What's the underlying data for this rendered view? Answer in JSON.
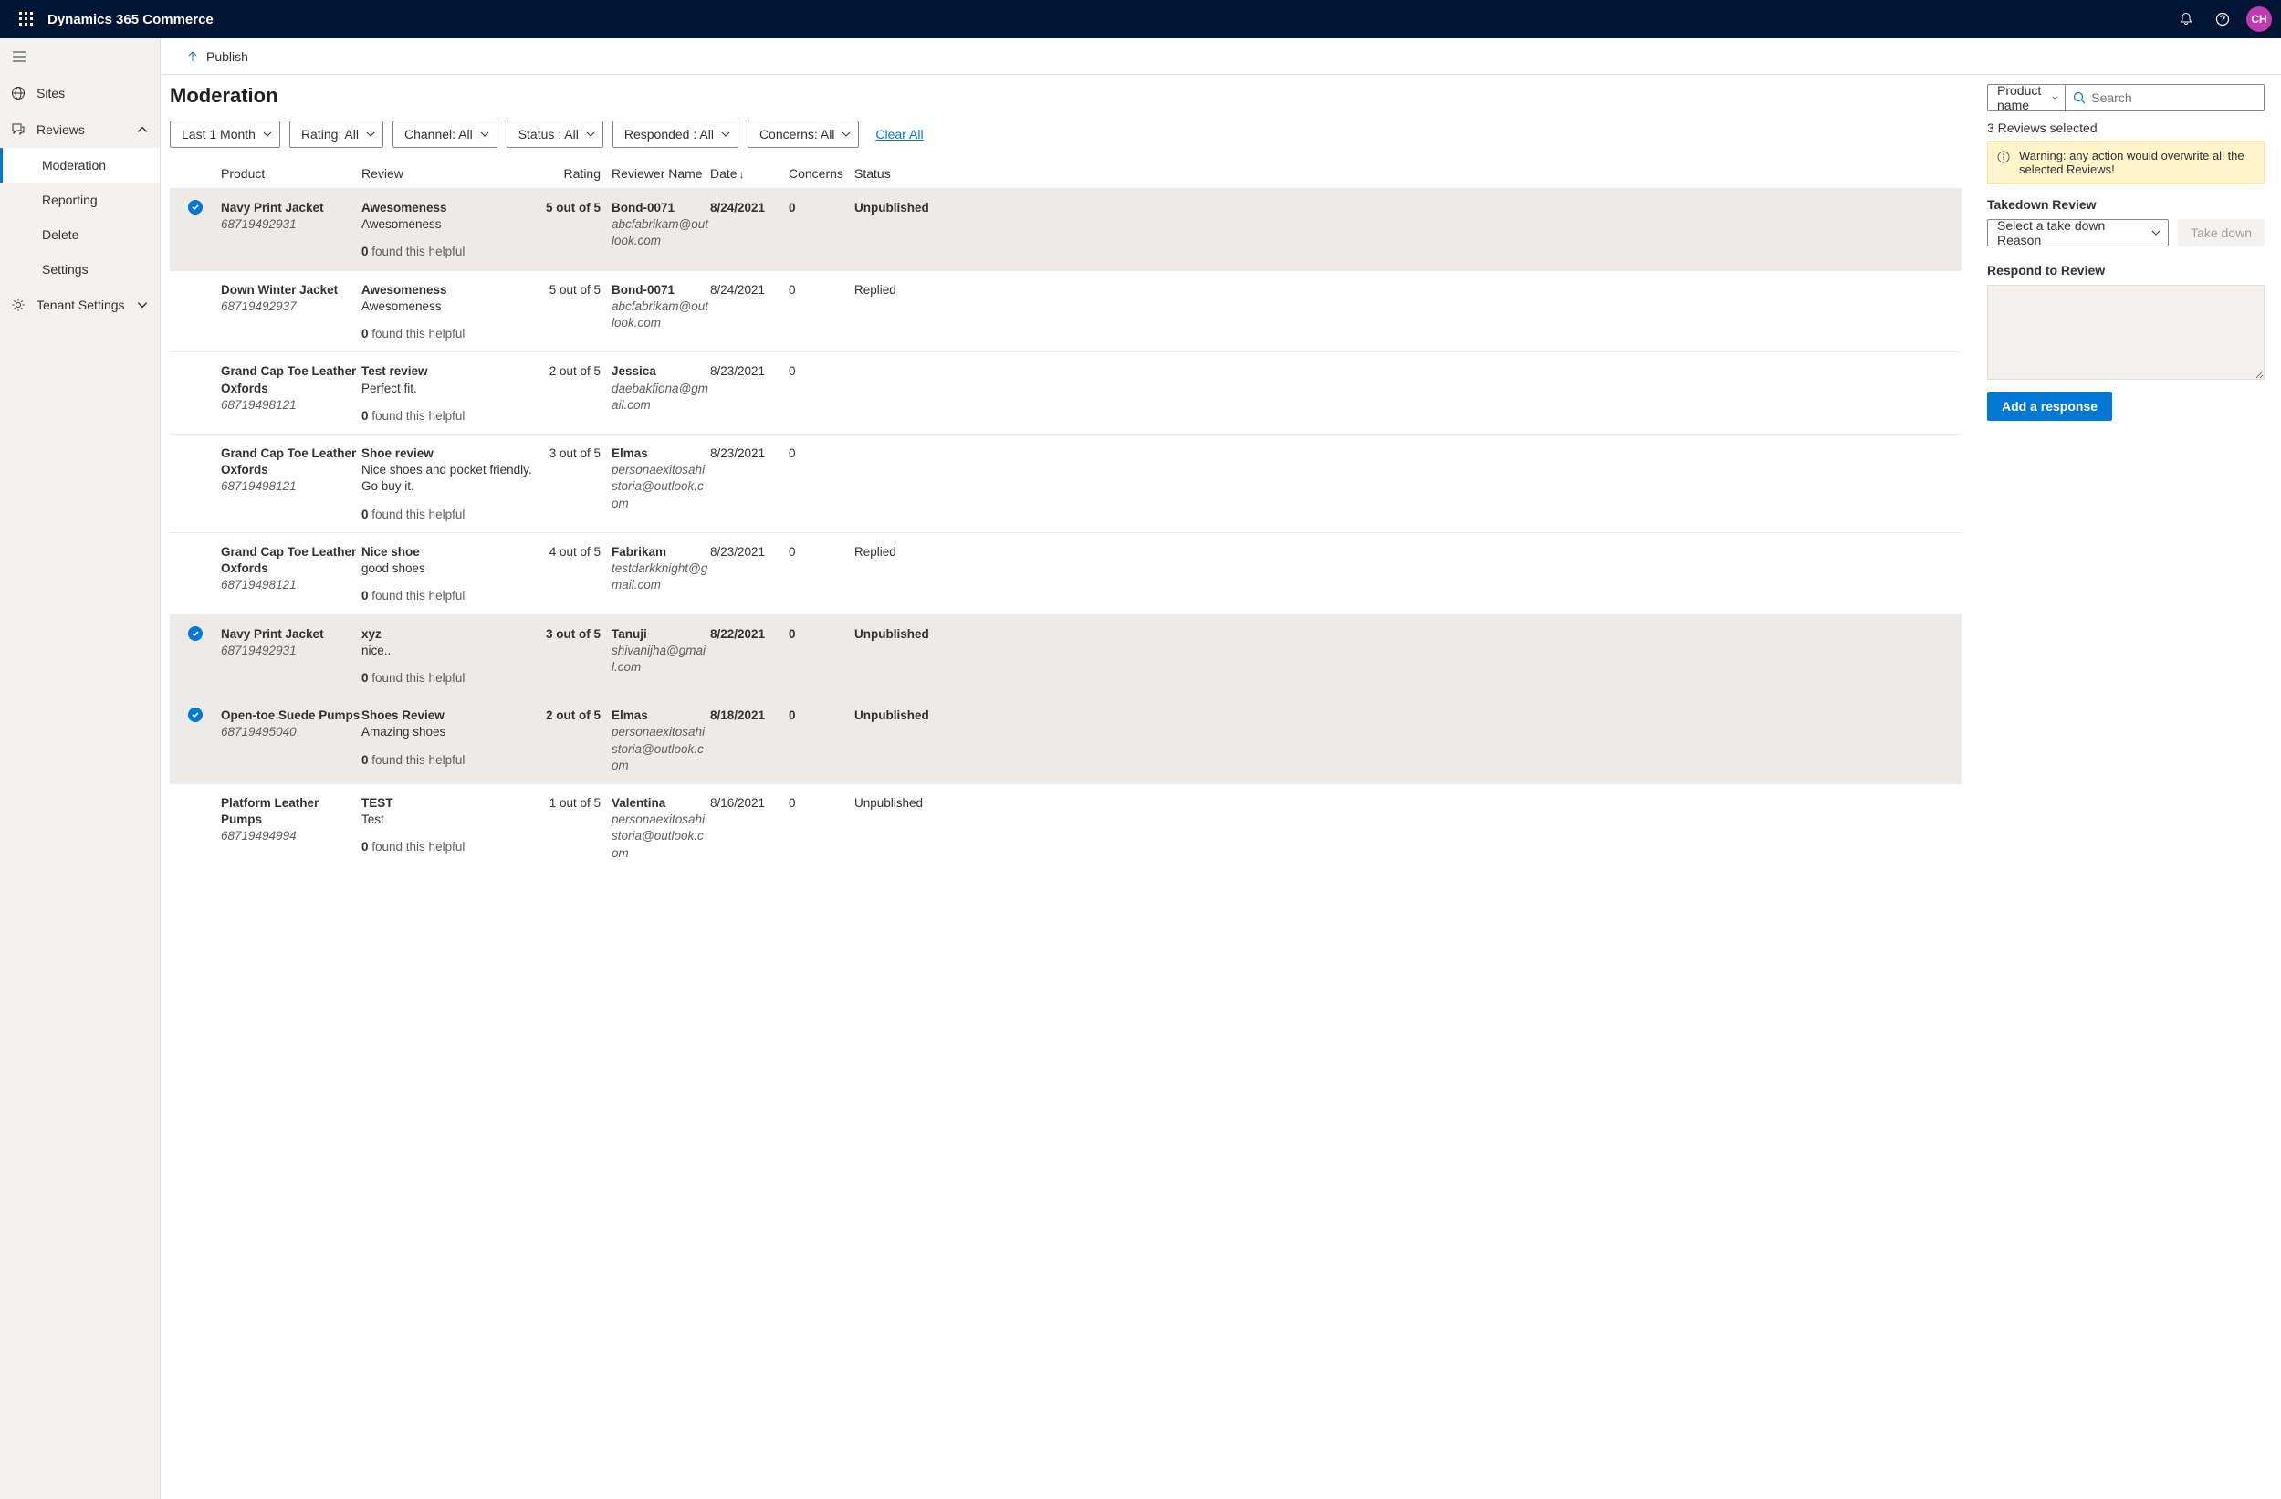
{
  "app_title": "Dynamics 365 Commerce",
  "avatar_initials": "CH",
  "publish_label": "Publish",
  "sidebar": {
    "items": [
      {
        "label": "Sites",
        "icon": "globe"
      },
      {
        "label": "Reviews",
        "icon": "review",
        "expanded": true
      },
      {
        "label": "Tenant Settings",
        "icon": "gear",
        "chev": "down"
      }
    ],
    "review_children": [
      {
        "label": "Moderation",
        "selected": true
      },
      {
        "label": "Reporting"
      },
      {
        "label": "Delete"
      },
      {
        "label": "Settings"
      }
    ]
  },
  "page_title": "Moderation",
  "filters": [
    "Last 1 Month",
    "Rating: All",
    "Channel: All",
    "Status : All",
    "Responded : All",
    "Concerns: All"
  ],
  "clear_all": "Clear All",
  "columns": {
    "product": "Product",
    "review": "Review",
    "rating": "Rating",
    "reviewer": "Reviewer Name",
    "date": "Date",
    "concerns": "Concerns",
    "status": "Status"
  },
  "helpful_prefix": "0",
  "helpful_suffix": " found this helpful",
  "rows": [
    {
      "selected": true,
      "product": "Navy Print Jacket",
      "sku": "68719492931",
      "title": "Awesomeness",
      "body": "Awesomeness",
      "rating": "5 out of 5",
      "reviewer": "Bond-0071",
      "email": "abcfabrikam@outlook.com",
      "date": "8/24/2021",
      "concerns": "0",
      "status": "Unpublished"
    },
    {
      "selected": false,
      "product": "Down Winter Jacket",
      "sku": "68719492937",
      "title": "Awesomeness",
      "body": "Awesomeness",
      "rating": "5 out of 5",
      "reviewer": "Bond-0071",
      "email": "abcfabrikam@outlook.com",
      "date": "8/24/2021",
      "concerns": "0",
      "status": "Replied"
    },
    {
      "selected": false,
      "product": "Grand Cap Toe Leather Oxfords",
      "sku": "68719498121",
      "title": "Test review",
      "body": "Perfect fit.",
      "rating": "2 out of 5",
      "reviewer": "Jessica",
      "email": "daebakfiona@gmail.com",
      "date": "8/23/2021",
      "concerns": "0",
      "status": ""
    },
    {
      "selected": false,
      "product": "Grand Cap Toe Leather Oxfords",
      "sku": "68719498121",
      "title": "Shoe review",
      "body": "Nice shoes and pocket friendly. Go buy it.",
      "rating": "3 out of 5",
      "reviewer": "Elmas",
      "email": "personaexitosahistoria@outlook.com",
      "date": "8/23/2021",
      "concerns": "0",
      "status": ""
    },
    {
      "selected": false,
      "product": "Grand Cap Toe Leather Oxfords",
      "sku": "68719498121",
      "title": "Nice shoe",
      "body": "good shoes",
      "rating": "4 out of 5",
      "reviewer": "Fabrikam",
      "email": "testdarkknight@gmail.com",
      "date": "8/23/2021",
      "concerns": "0",
      "status": "Replied"
    },
    {
      "selected": true,
      "product": "Navy Print Jacket",
      "sku": "68719492931",
      "title": "xyz",
      "body": "nice..",
      "rating": "3 out of 5",
      "reviewer": "Tanuji",
      "email": "shivanijha@gmail.com",
      "date": "8/22/2021",
      "concerns": "0",
      "status": "Unpublished"
    },
    {
      "selected": true,
      "product": "Open-toe Suede Pumps",
      "sku": "68719495040",
      "title": "Shoes Review",
      "body": "Amazing shoes",
      "rating": "2 out of 5",
      "reviewer": "Elmas",
      "email": "personaexitosahistoria@outlook.com",
      "date": "8/18/2021",
      "concerns": "0",
      "status": "Unpublished"
    },
    {
      "selected": false,
      "product": "Platform Leather Pumps",
      "sku": "68719494994",
      "title": "TEST",
      "body": "Test",
      "rating": "1 out of 5",
      "reviewer": "Valentina",
      "email": "personaexitosahistoria@outlook.com",
      "date": "8/16/2021",
      "concerns": "0",
      "status": "Unpublished"
    }
  ],
  "right": {
    "dropdown_label": "Product name",
    "search_placeholder": "Search",
    "selected_text": "3 Reviews selected",
    "warning_text": "Warning: any action would overwrite all the selected Reviews!",
    "takedown_label": "Takedown Review",
    "takedown_select": "Select a take down Reason",
    "takedown_button": "Take down",
    "respond_label": "Respond to Review",
    "add_response": "Add a response"
  }
}
